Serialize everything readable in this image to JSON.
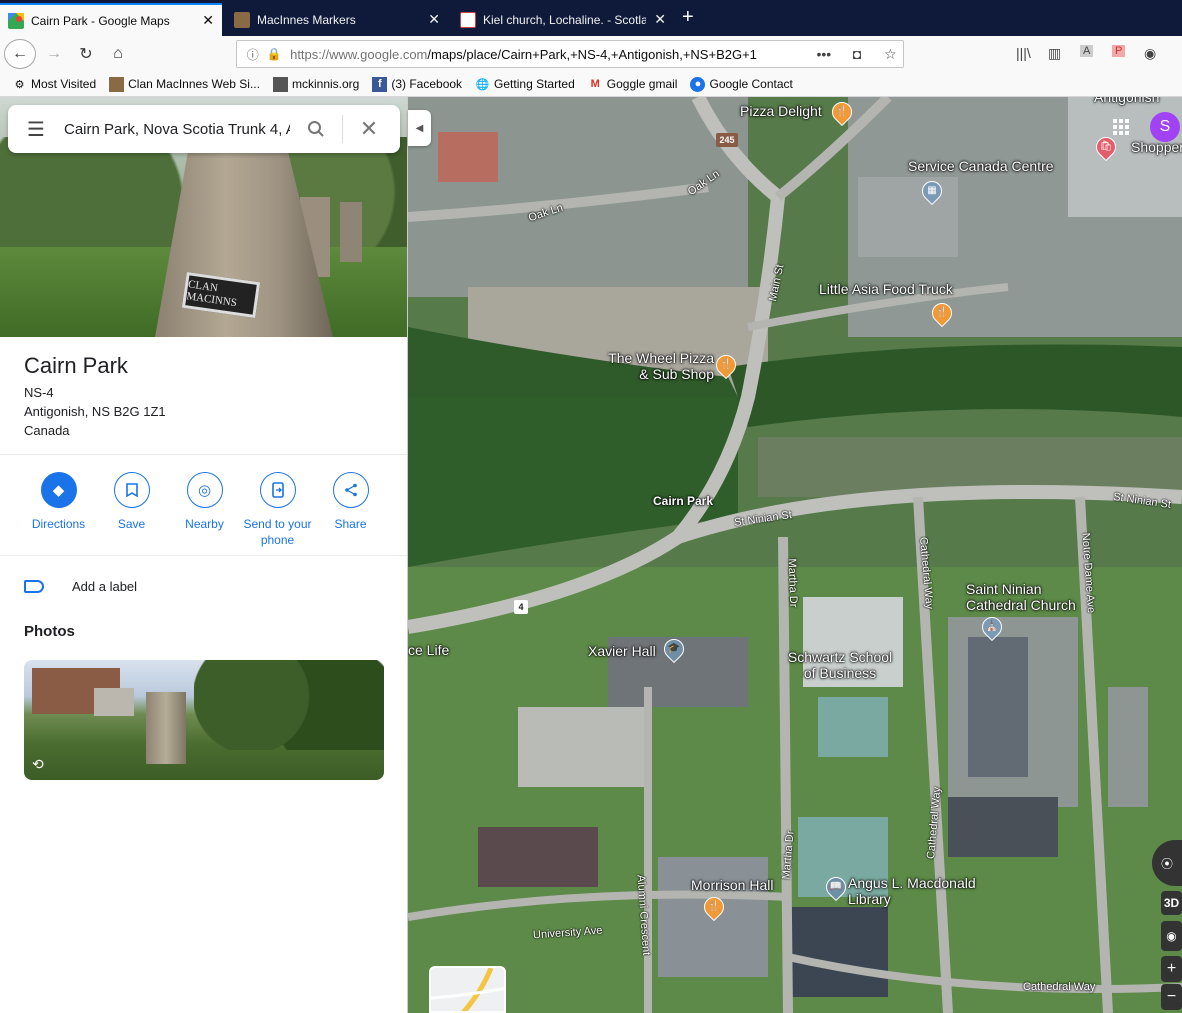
{
  "browser": {
    "tabs": [
      {
        "label": "Cairn Park - Google Maps",
        "active": true
      },
      {
        "label": "MacInnes Markers",
        "active": false
      },
      {
        "label": "Kiel church, Lochaline. - Scotla",
        "active": false
      }
    ],
    "url_host": "https://www.google.com",
    "url_path": "/maps/place/Cairn+Park,+NS-4,+Antigonish,+NS+B2G+1",
    "bookmarks": [
      "Most Visited",
      "Clan MacInnes Web Si...",
      "mckinnis.org",
      "(3) Facebook",
      "Getting Started",
      "Goggle gmail",
      "Google Contact"
    ]
  },
  "search": {
    "value": "Cairn Park, Nova Scotia Trunk 4, A"
  },
  "place": {
    "photo_plaque": "CLAN MACINNS",
    "title": "Cairn Park",
    "address_lines": [
      "NS-4",
      "Antigonish, NS B2G 1Z1",
      "Canada"
    ]
  },
  "actions": [
    {
      "label": "Directions"
    },
    {
      "label": "Save"
    },
    {
      "label": "Nearby"
    },
    {
      "label": "Send to your phone"
    },
    {
      "label": "Share"
    }
  ],
  "add_label": "Add a label",
  "photos_heading": "Photos",
  "map": {
    "avatar_letter": "S",
    "controls_3d": "3D",
    "places": [
      {
        "name": "Pizza Delight"
      },
      {
        "name": "Service Canada Centre"
      },
      {
        "name": "Little Asia Food Truck"
      },
      {
        "name": "The Wheel Pizza & Sub Shop"
      },
      {
        "name": "Cairn Park"
      },
      {
        "name": "Xavier Hall"
      },
      {
        "name": "Schwartz School of Business"
      },
      {
        "name": "Saint Ninian Cathedral Church"
      },
      {
        "name": "Morrison Hall"
      },
      {
        "name": "Angus L. Macdonald Library"
      },
      {
        "name": "Shoppers"
      },
      {
        "name": "Antigonish"
      },
      {
        "name": "ce Life"
      }
    ],
    "roads": {
      "oak_ln_1": "Oak Ln",
      "oak_ln_2": "Oak Ln",
      "main_st": "Main St",
      "st_ninian_1": "St Ninian St",
      "st_ninian_2": "St Ninian St",
      "martha_dr_1": "Martha Dr",
      "martha_dr_2": "Martha Dr",
      "cathedral_way_1": "Cathedral Way",
      "cathedral_way_2": "Cathedral Way",
      "cathedral_way_3": "Cathedral Way",
      "notre_dame": "Notre Dame Ave",
      "alumni_crescent": "Alumni Crescent",
      "university_ave": "University Ave",
      "route_245": "245",
      "route_4": "4"
    }
  }
}
